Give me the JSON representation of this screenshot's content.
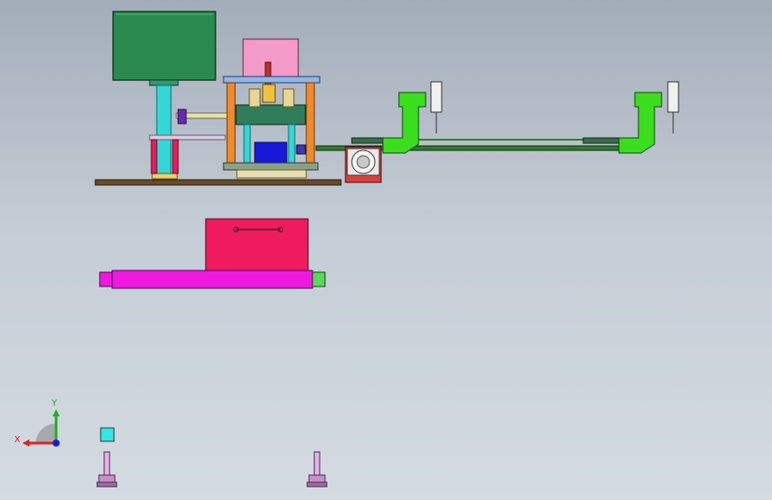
{
  "viewport": {
    "background_top": "#a3adb9",
    "background_bottom": "#d4dbe2"
  },
  "triad": {
    "x_label": "X",
    "y_label": "Y",
    "x_color": "#e0201b",
    "y_color": "#1fb21f",
    "z_color": "#1a1ae6"
  },
  "colors": {
    "panel_green": "#2a8a4e",
    "column_cyan": "#35d6d6",
    "pink": "#f49ac8",
    "orange": "#f08a2e",
    "blue": "#1818d8",
    "lime": "#3cdc1e",
    "crimson": "#ee1c5e",
    "magenta": "#ee18e0",
    "base_brown": "#6b4a2a",
    "rail_green": "#2f7d2f"
  },
  "icons": {
    "triad": "coordinate-triad-icon",
    "origin_cube": "cube-icon",
    "foot": "leveling-foot-icon"
  }
}
